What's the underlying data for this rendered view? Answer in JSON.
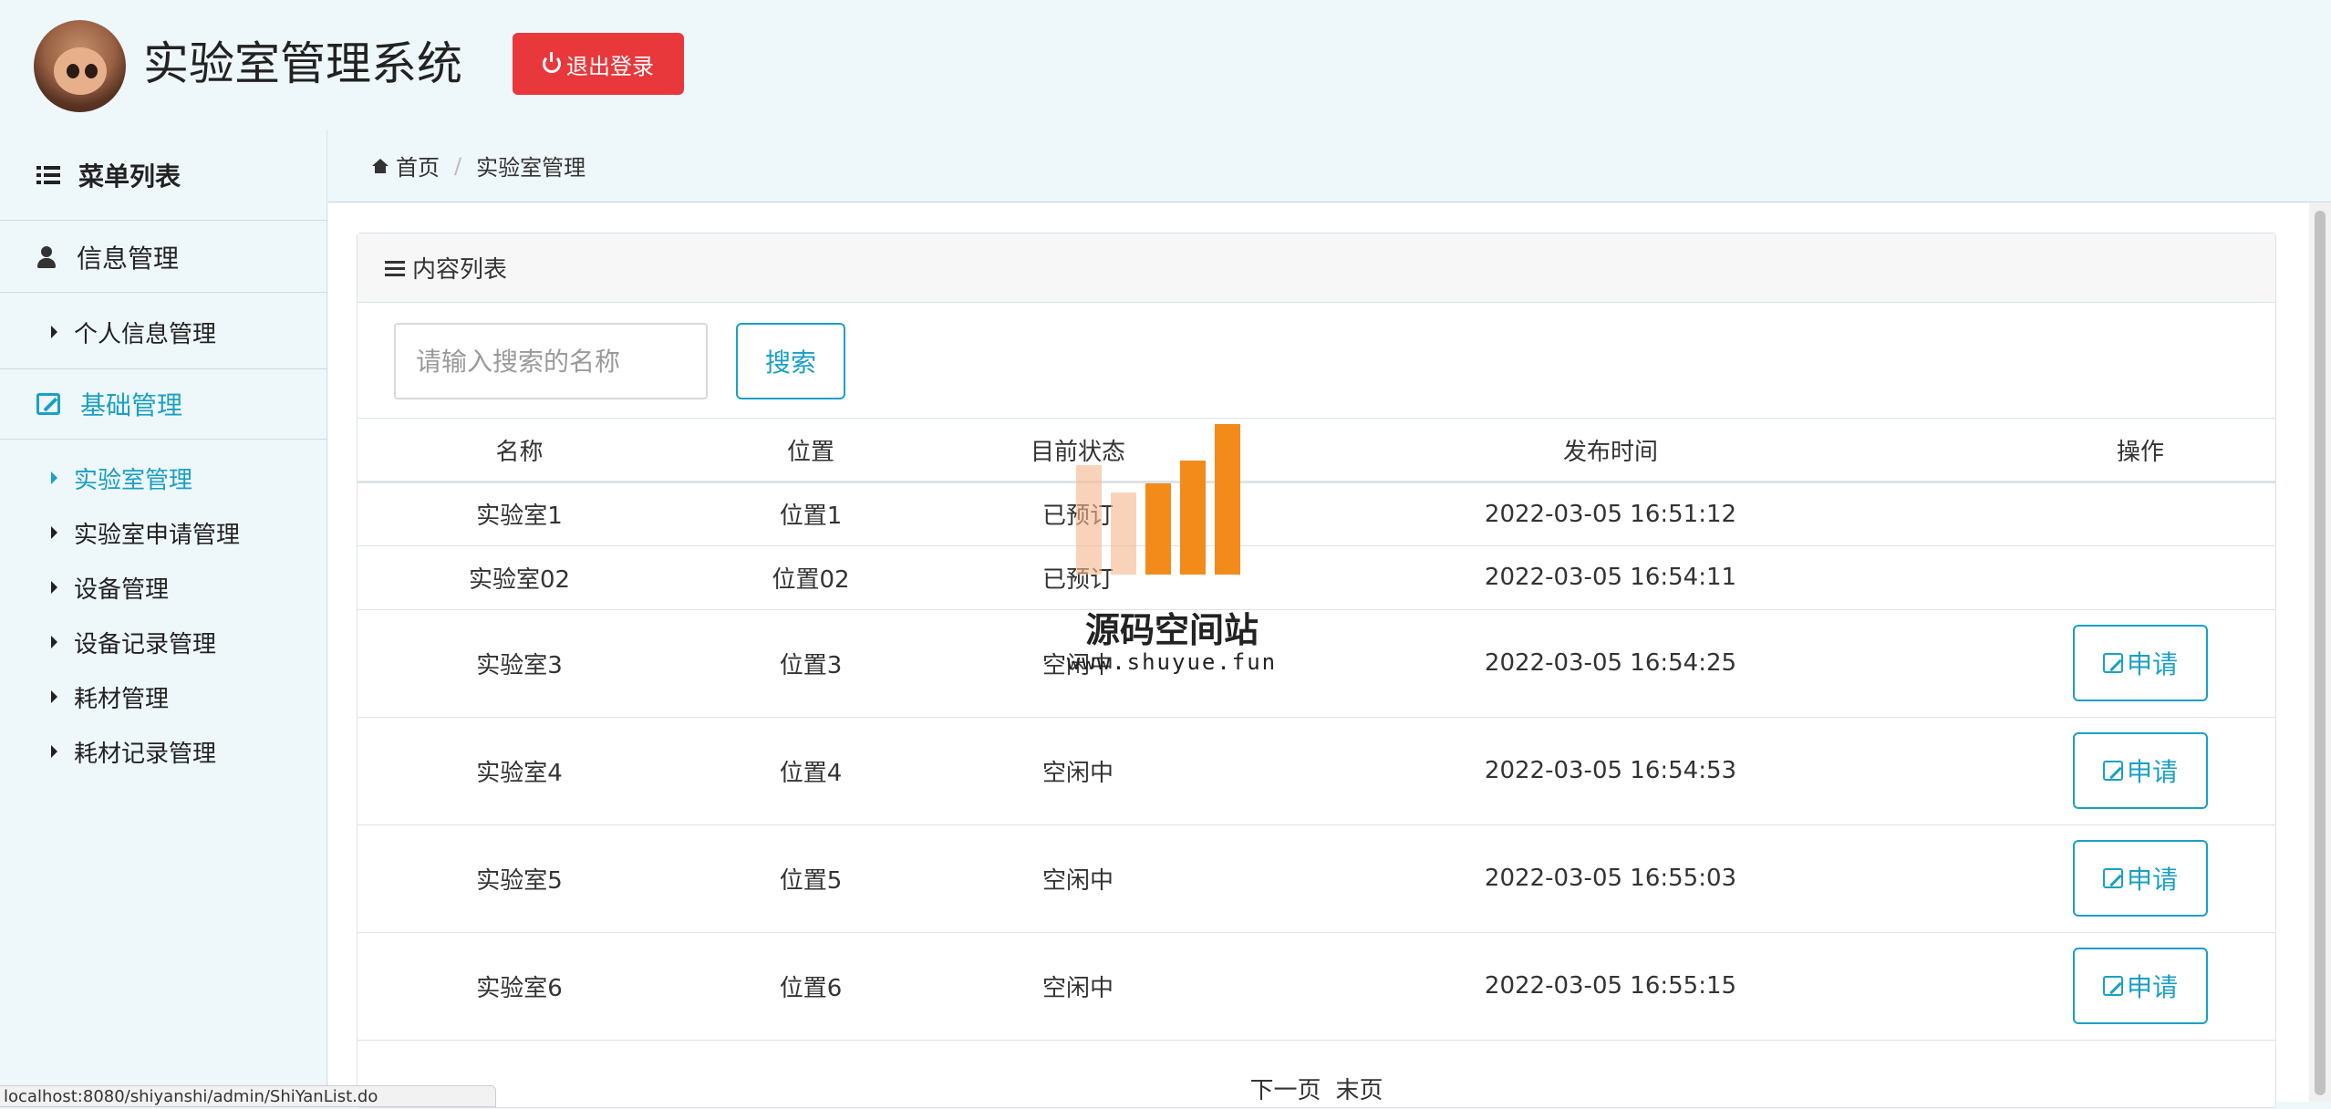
{
  "header": {
    "title": "实验室管理系统",
    "logout_label": "退出登录"
  },
  "sidebar": {
    "menu_title": "菜单列表",
    "groups": [
      {
        "label": "信息管理",
        "items": [
          {
            "label": "个人信息管理"
          }
        ]
      },
      {
        "label": "基础管理",
        "items": [
          {
            "label": "实验室管理"
          },
          {
            "label": "实验室申请管理"
          },
          {
            "label": "设备管理"
          },
          {
            "label": "设备记录管理"
          },
          {
            "label": "耗材管理"
          },
          {
            "label": "耗材记录管理"
          }
        ]
      }
    ]
  },
  "breadcrumb": {
    "home": "首页",
    "current": "实验室管理"
  },
  "panel": {
    "title": "内容列表"
  },
  "search": {
    "placeholder": "请输入搜索的名称",
    "button_label": "搜索"
  },
  "table": {
    "headers": [
      "名称",
      "位置",
      "目前状态",
      "发布时间",
      "操作"
    ],
    "rows": [
      {
        "name": "实验室1",
        "location": "位置1",
        "status": "已预订",
        "time": "2022-03-05 16:51:12",
        "action": ""
      },
      {
        "name": "实验室02",
        "location": "位置02",
        "status": "已预订",
        "time": "2022-03-05 16:54:11",
        "action": ""
      },
      {
        "name": "实验室3",
        "location": "位置3",
        "status": "空闲中",
        "time": "2022-03-05 16:54:25",
        "action": "申请"
      },
      {
        "name": "实验室4",
        "location": "位置4",
        "status": "空闲中",
        "time": "2022-03-05 16:54:53",
        "action": "申请"
      },
      {
        "name": "实验室5",
        "location": "位置5",
        "status": "空闲中",
        "time": "2022-03-05 16:55:03",
        "action": "申请"
      },
      {
        "name": "实验室6",
        "location": "位置6",
        "status": "空闲中",
        "time": "2022-03-05 16:55:15",
        "action": "申请"
      }
    ]
  },
  "pager": {
    "next": "下一页",
    "last": "末页"
  },
  "watermark": {
    "title": "源码空间站",
    "url": "www.shuyue.fun"
  },
  "status_bar": {
    "url": "localhost:8080/shiyanshi/admin/ShiYanList.do"
  },
  "colors": {
    "accent": "#1aa0c4",
    "danger": "#e8383c",
    "background": "#eef7fa"
  }
}
